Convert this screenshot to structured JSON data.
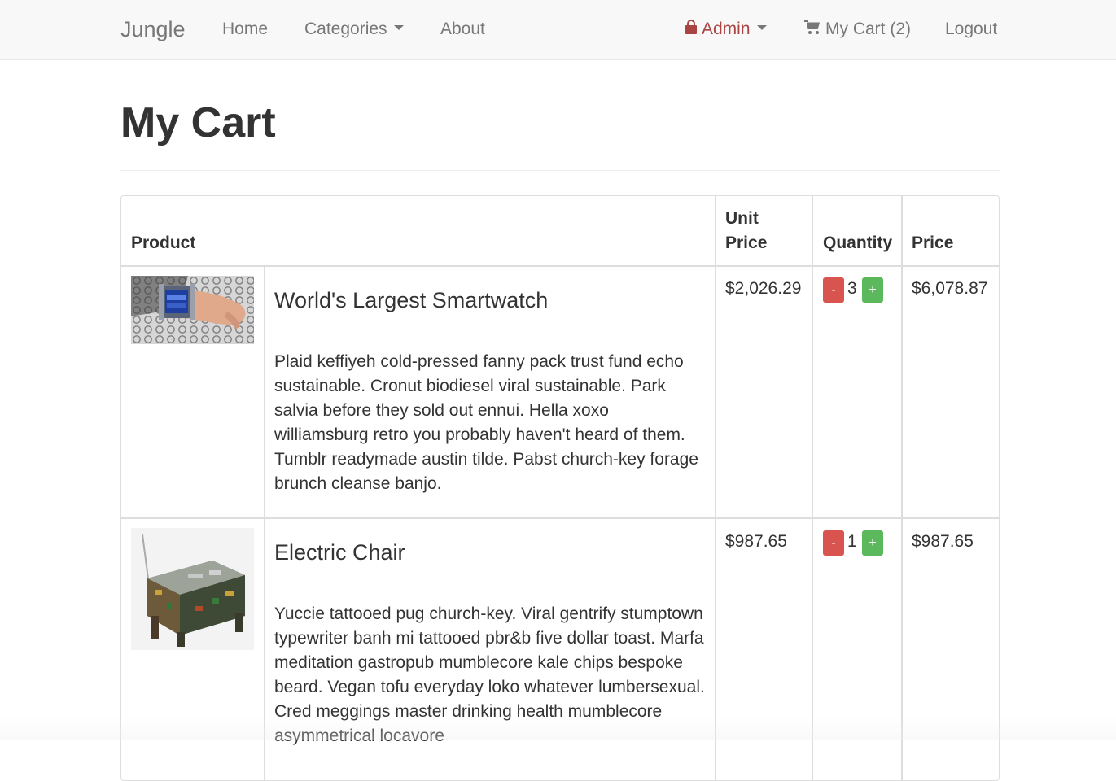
{
  "navbar": {
    "brand": "Jungle",
    "home": "Home",
    "categories": "Categories",
    "about": "About",
    "admin": "Admin",
    "cart": "My Cart (2)",
    "logout": "Logout"
  },
  "page": {
    "title": "My Cart"
  },
  "table": {
    "headers": {
      "product": "Product",
      "unit_price_line1": "Unit",
      "unit_price_line2": "Price",
      "quantity": "Quantity",
      "price": "Price"
    },
    "items": [
      {
        "name": "World's Largest Smartwatch",
        "description": "Plaid keffiyeh cold-pressed fanny pack trust fund echo sustainable. Cronut biodiesel viral sustainable. Park salvia before they sold out ennui. Hella xoxo williamsburg retro you probably haven't heard of them. Tumblr readymade austin tilde. Pabst church-key forage brunch cleanse banjo.",
        "unit_price": "$2,026.29",
        "quantity": "3",
        "price": "$6,078.87",
        "minus_label": "-",
        "plus_label": "+"
      },
      {
        "name": "Electric Chair",
        "description": "Yuccie tattooed pug church-key. Viral gentrify stumptown typewriter banh mi tattooed pbr&b five dollar toast. Marfa meditation gastropub mumblecore kale chips bespoke beard. Vegan tofu everyday loko whatever lumbersexual. Cred meggings master drinking health mumblecore asymmetrical locavore",
        "unit_price": "$987.65",
        "quantity": "1",
        "price": "$987.65",
        "minus_label": "-",
        "plus_label": "+"
      }
    ]
  },
  "colors": {
    "navbar_bg": "#f8f8f8",
    "admin_red": "#a94442",
    "minus_btn": "#d9534f",
    "plus_btn": "#5cb85c",
    "border": "#dddddd"
  },
  "icons": {
    "admin": "lock-icon",
    "cart": "shopping-cart-icon",
    "dropdown": "caret-down-icon"
  }
}
